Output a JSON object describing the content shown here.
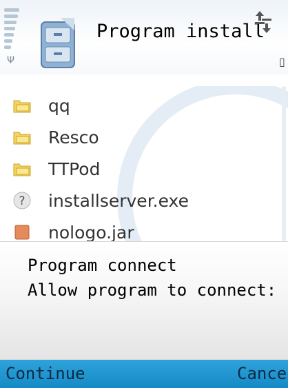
{
  "title": "Program install",
  "list_items": [
    {
      "label": "qq",
      "icon": "folder-icon"
    },
    {
      "label": "Resco",
      "icon": "folder-icon"
    },
    {
      "label": "TTPod",
      "icon": "folder-icon"
    },
    {
      "label": "installserver.exe",
      "icon": "unknown-file-icon"
    },
    {
      "label": "nologo.jar",
      "icon": "java-app-icon"
    }
  ],
  "dialog": {
    "title": "Program connect",
    "message": "Allow program to connect:"
  },
  "softkeys": {
    "left": "Continue",
    "right": "Cancel"
  },
  "colors": {
    "softkey_bar": "#1e94cf",
    "folder": "#f3d35a",
    "signal": "#b7c6d3"
  }
}
